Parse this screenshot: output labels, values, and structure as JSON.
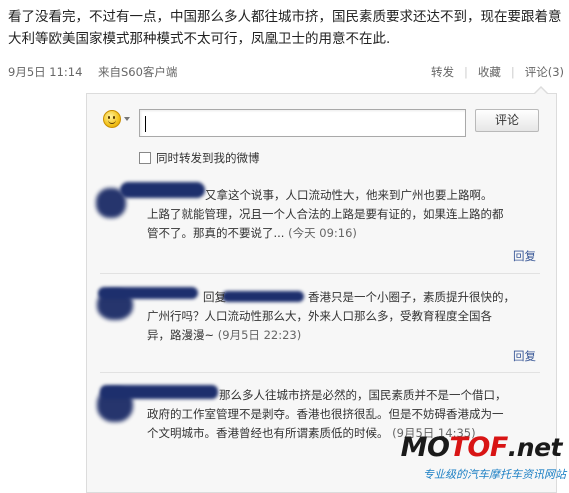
{
  "post": {
    "text": "看了没看完，不过有一点，中国那么多人都往城市挤，国民素质要求还达不到，现在要跟着意大利等欧美国家模式那种模式不太可行，凤凰卫士的用意不在此."
  },
  "meta": {
    "time": "9月5日 11:14",
    "source": "来自S60客户端",
    "forward": "转发",
    "favorite": "收藏",
    "comment": "评论(3)"
  },
  "composer": {
    "emoji_icon": "smiley-icon",
    "input_value": "",
    "submit_label": "评论",
    "forward_label": "同时转发到我的微博"
  },
  "comments": [
    {
      "line1": "又拿这个说事，人口流动性大，他来到广州也要上路啊。",
      "line2": "上路了就能管理，况且一个人合法的上路是要有证的，如果连上路的都",
      "line3": "管不了。那真的不要说了...",
      "time": "(今天 09:16)",
      "reply": "回复"
    },
    {
      "prefix": "回复",
      "line1": "香港只是一个小圈子，素质提升很快的，",
      "line2": "广州行吗？人口流动性那么大，外来人口那么多，受教育程度全国各",
      "line3": "异，路漫漫~",
      "time": "(9月5日 22:23)",
      "reply": "回复"
    },
    {
      "line1": "那么多人往城市挤是必然的，国民素质并不是一个借口，",
      "line2": "政府的工作室管理不是剥夺。香港也很挤很乱。但是不妨碍香港成为一",
      "line3": "个文明城市。香港曾经也有所谓素质低的时候。",
      "time": "(9月5日 14:35)"
    }
  ],
  "watermark": {
    "logo_mo": "MO",
    "logo_tof": "TOF",
    "logo_net": ".net",
    "slogan": "专业级的汽车摩托车资讯网站"
  },
  "colors": {
    "link": "#3b5998",
    "panel_bg": "#f7f7f7",
    "panel_border": "#dcdcdc",
    "logo_red": "#d81414",
    "slogan_blue": "#1b7fc4"
  }
}
